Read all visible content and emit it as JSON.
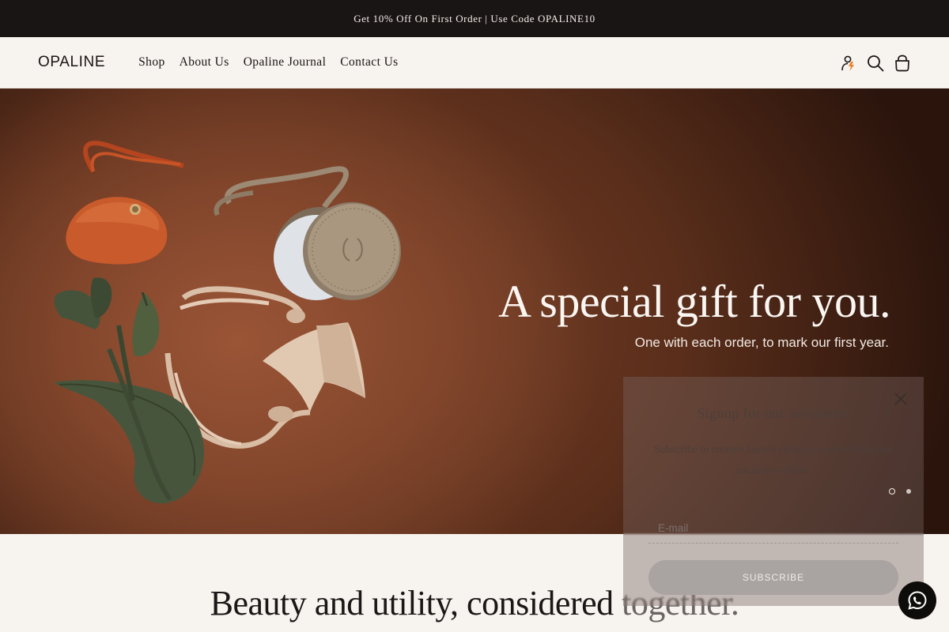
{
  "announcement": {
    "text": "Get 10% Off On First Order | Use Code OPALINE10"
  },
  "header": {
    "logo": "OPALINE",
    "nav": [
      {
        "label": "Shop"
      },
      {
        "label": "About Us"
      },
      {
        "label": "Opaline Journal"
      },
      {
        "label": "Contact Us"
      }
    ],
    "icons": [
      "account-icon",
      "search-icon",
      "bag-icon"
    ]
  },
  "hero": {
    "title": "A special gift for you.",
    "subtitle": "One with each order, to mark our first year."
  },
  "section": {
    "tagline_main": "Beauty and utility, considered ",
    "tagline_fade": "together."
  },
  "newsletter": {
    "title": "Signup for our newsletter",
    "text": "Subscribe to receive launch updates, curated edits and exclusive offers.",
    "email_placeholder": "E-mail",
    "button_label": "SUBSCRIBE",
    "slides": 2,
    "active_slide": 1
  },
  "colors": {
    "announcement_bg": "#1a1515",
    "header_bg": "#f7f3ef",
    "hero_brown": "#7d4329",
    "button_grey": "#a9a3a1",
    "whatsapp_bg": "#0e0b0b"
  }
}
